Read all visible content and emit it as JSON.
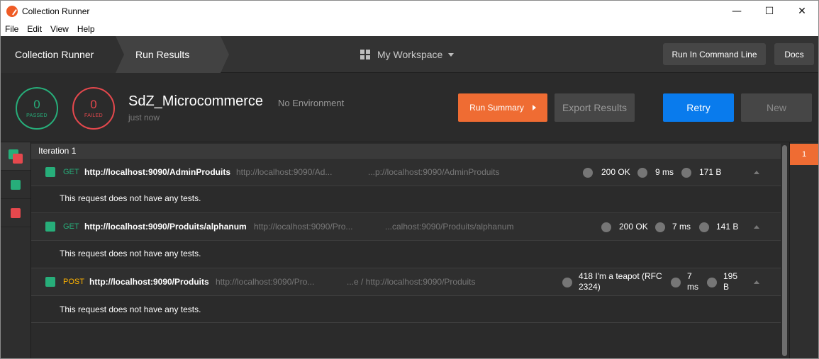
{
  "window": {
    "title": "Collection Runner",
    "controls": {
      "minimize": "—",
      "maximize": "☐",
      "close": "✕"
    }
  },
  "menu": [
    "File",
    "Edit",
    "View",
    "Help"
  ],
  "header": {
    "breadcrumb": [
      "Collection Runner",
      "Run Results"
    ],
    "workspace": "My Workspace",
    "run_cli_label": "Run In Command Line",
    "docs_label": "Docs"
  },
  "summary": {
    "passed_count": "0",
    "passed_label": "PASSED",
    "failed_count": "0",
    "failed_label": "FAILED",
    "collection_name": "SdZ_Microcommerce",
    "environment": "No Environment",
    "time": "just now",
    "run_summary_label": "Run Summary",
    "export_label": "Export Results",
    "retry_label": "Retry",
    "new_label": "New"
  },
  "colors": {
    "passed": "#27ae7a",
    "failed": "#e5484d",
    "accent_orange": "#ef6c33",
    "retry_blue": "#097bed",
    "get_method": "#27ae7a",
    "post_method": "#ffb400"
  },
  "iteration": {
    "label": "Iteration 1",
    "requests": [
      {
        "method": "GET",
        "url": "http://localhost:9090/AdminProduits",
        "url_gray_1": "http://localhost:9090/Ad...",
        "url_gray_2": "...p://localhost:9090/AdminProduits",
        "status": "200 OK",
        "time": "9 ms",
        "size": "171 B",
        "tests_message": "This request does not have any tests."
      },
      {
        "method": "GET",
        "url": "http://localhost:9090/Produits/alphanum",
        "url_gray_1": "http://localhost:9090/Pro...",
        "url_gray_2": "...calhost:9090/Produits/alphanum",
        "status": "200 OK",
        "time": "7 ms",
        "size": "141 B",
        "tests_message": "This request does not have any tests."
      },
      {
        "method": "POST",
        "url": "http://localhost:9090/Produits",
        "url_gray_1": "http://localhost:9090/Pro...",
        "url_gray_2": "...e / http://localhost:9090/Produits",
        "status_line1": "418 I'm a teapot (RFC",
        "status_line2": "2324)",
        "time_line1": "7",
        "time_line2": "ms",
        "size_line1": "195",
        "size_line2": "B",
        "tests_message": "This request does not have any tests."
      }
    ]
  },
  "right_panel": {
    "iteration_number": "1"
  }
}
